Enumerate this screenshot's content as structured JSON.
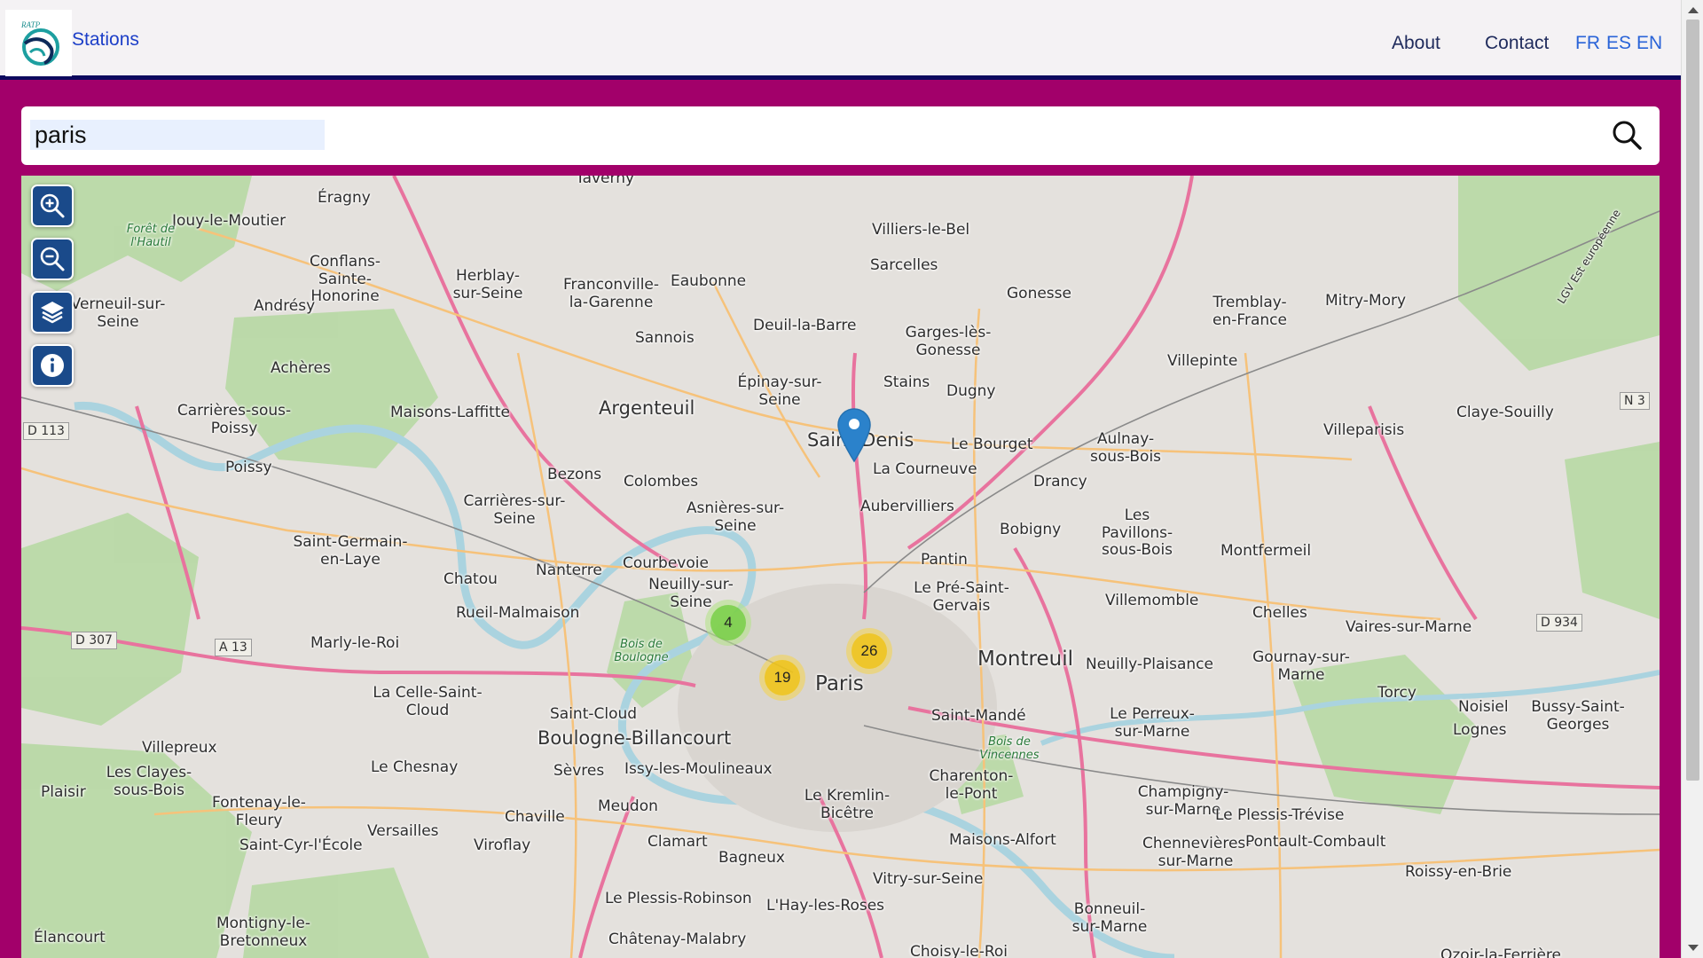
{
  "header": {
    "brand": "Stations",
    "logo_text": "RATP",
    "nav": [
      {
        "label": "About"
      },
      {
        "label": "Contact"
      }
    ],
    "languages": [
      {
        "label": "FR"
      },
      {
        "label": "ES"
      },
      {
        "label": "EN"
      }
    ]
  },
  "search": {
    "value": "paris",
    "icon": "search-icon"
  },
  "map": {
    "controls": [
      {
        "name": "zoom-in",
        "icon": "zoom-in-icon"
      },
      {
        "name": "zoom-out",
        "icon": "zoom-out-icon"
      },
      {
        "name": "layers",
        "icon": "layers-icon"
      },
      {
        "name": "info",
        "icon": "info-icon"
      }
    ],
    "clusters": [
      {
        "count": "4",
        "color": "#6ecc39"
      },
      {
        "count": "26",
        "color": "#f0c20c"
      },
      {
        "count": "19",
        "color": "#f0c20c"
      }
    ],
    "marker_icon": "map-pin-icon",
    "places": [
      {
        "name": "Taverny"
      },
      {
        "name": "Éragny"
      },
      {
        "name": "Jouy-le-Moutier"
      },
      {
        "name": "Forêt de l'Hautil"
      },
      {
        "name": "Conflans-Sainte-Honorine"
      },
      {
        "name": "Herblay-sur-Seine"
      },
      {
        "name": "Franconville-la-Garenne"
      },
      {
        "name": "Eaubonne"
      },
      {
        "name": "Villiers-le-Bel"
      },
      {
        "name": "Sarcelles"
      },
      {
        "name": "Gonesse"
      },
      {
        "name": "Tremblay-en-France"
      },
      {
        "name": "Mitry-Mory"
      },
      {
        "name": "Verneuil-sur-Seine"
      },
      {
        "name": "Andrésy"
      },
      {
        "name": "Deuil-la-Barre"
      },
      {
        "name": "Sannois"
      },
      {
        "name": "Garges-lès-Gonesse"
      },
      {
        "name": "Villepinte"
      },
      {
        "name": "Achères"
      },
      {
        "name": "Épinay-sur-Seine"
      },
      {
        "name": "Stains"
      },
      {
        "name": "Dugny"
      },
      {
        "name": "Carrières-sous-Poissy"
      },
      {
        "name": "Maisons-Laffitte"
      },
      {
        "name": "Argenteuil"
      },
      {
        "name": "Claye-Souilly"
      },
      {
        "name": "Villeparisis"
      },
      {
        "name": "Saint-Denis"
      },
      {
        "name": "Le Bourget"
      },
      {
        "name": "Aulnay-sous-Bois"
      },
      {
        "name": "Poissy"
      },
      {
        "name": "Bezons"
      },
      {
        "name": "Colombes"
      },
      {
        "name": "La Courneuve"
      },
      {
        "name": "Drancy"
      },
      {
        "name": "Carrières-sur-Seine"
      },
      {
        "name": "Asnières-sur-Seine"
      },
      {
        "name": "Aubervilliers"
      },
      {
        "name": "Les Pavillons-sous-Bois"
      },
      {
        "name": "Bobigny"
      },
      {
        "name": "Saint-Germain-en-Laye"
      },
      {
        "name": "Nanterre"
      },
      {
        "name": "Courbevoie"
      },
      {
        "name": "Montfermeil"
      },
      {
        "name": "Chatou"
      },
      {
        "name": "Neuilly-sur-Seine"
      },
      {
        "name": "Pantin"
      },
      {
        "name": "Le Pré-Saint-Gervais"
      },
      {
        "name": "Villemomble"
      },
      {
        "name": "Rueil-Malmaison"
      },
      {
        "name": "Chelles"
      },
      {
        "name": "Vaires-sur-Marne"
      },
      {
        "name": "Marly-le-Roi"
      },
      {
        "name": "Bois de Boulogne"
      },
      {
        "name": "Montreuil"
      },
      {
        "name": "Neuilly-Plaisance"
      },
      {
        "name": "Gournay-sur-Marne"
      },
      {
        "name": "Paris"
      },
      {
        "name": "Torcy"
      },
      {
        "name": "La Celle-Saint-Cloud"
      },
      {
        "name": "Noisiel"
      },
      {
        "name": "Bussy-Saint-Georges"
      },
      {
        "name": "Saint-Cloud"
      },
      {
        "name": "Saint-Mandé"
      },
      {
        "name": "Le Perreux-sur-Marne"
      },
      {
        "name": "Lognes"
      },
      {
        "name": "Boulogne-Billancourt"
      },
      {
        "name": "Bois de Vincennes"
      },
      {
        "name": "Villepreux"
      },
      {
        "name": "Le Chesnay"
      },
      {
        "name": "Sèvres"
      },
      {
        "name": "Issy-les-Moulineaux"
      },
      {
        "name": "Charenton-le-Pont"
      },
      {
        "name": "Les Clayes-sous-Bois"
      },
      {
        "name": "Plaisir"
      },
      {
        "name": "Fontenay-le-Fleury"
      },
      {
        "name": "Meudon"
      },
      {
        "name": "Le Kremlin-Bicêtre"
      },
      {
        "name": "Champigny-sur-Marne"
      },
      {
        "name": "Le Plessis-Trévise"
      },
      {
        "name": "Chaville"
      },
      {
        "name": "Versailles"
      },
      {
        "name": "Saint-Cyr-l'École"
      },
      {
        "name": "Viroflay"
      },
      {
        "name": "Clamart"
      },
      {
        "name": "Maisons-Alfort"
      },
      {
        "name": "Chennevières-sur-Marne"
      },
      {
        "name": "Pontault-Combault"
      },
      {
        "name": "Bagneux"
      },
      {
        "name": "Vitry-sur-Seine"
      },
      {
        "name": "Roissy-en-Brie"
      },
      {
        "name": "Le Plessis-Robinson"
      },
      {
        "name": "L'Hay-les-Roses"
      },
      {
        "name": "Bonneuil-sur-Marne"
      },
      {
        "name": "Élancourt"
      },
      {
        "name": "Montigny-le-Bretonneux"
      },
      {
        "name": "Châtenay-Malabry"
      },
      {
        "name": "Choisy-le-Roi"
      },
      {
        "name": "Ozoir-la-Ferrière"
      }
    ],
    "roads": [
      {
        "label": "D 113"
      },
      {
        "label": "D 307"
      },
      {
        "label": "A 13"
      },
      {
        "label": "N 3"
      },
      {
        "label": "D 934"
      },
      {
        "label": "LGV Est européenne"
      }
    ]
  }
}
